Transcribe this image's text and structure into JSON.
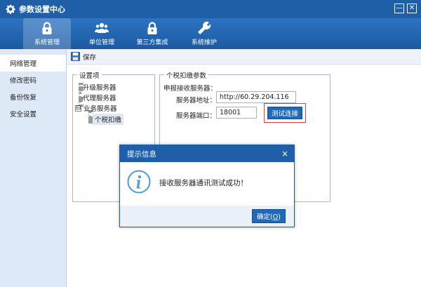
{
  "window": {
    "title": "参数设置中心",
    "icons": {
      "app": "gear-icon",
      "minimize": "minimize-icon",
      "close": "close-icon"
    },
    "minimize_glyph": "—",
    "close_glyph": "✕"
  },
  "nav": {
    "tabs": [
      {
        "label": "系统管理",
        "icon": "lock-icon",
        "active": true
      },
      {
        "label": "单位管理",
        "icon": "users-icon",
        "active": false
      },
      {
        "label": "第三方集成",
        "icon": "lock-icon",
        "active": false
      },
      {
        "label": "系统维护",
        "icon": "wrench-icon",
        "active": false
      }
    ]
  },
  "sidebar": {
    "items": [
      {
        "label": "网络管理",
        "active": true
      },
      {
        "label": "修改密码",
        "active": false
      },
      {
        "label": "备份恢复",
        "active": false
      },
      {
        "label": "安全设置",
        "active": false
      }
    ]
  },
  "toolbar": {
    "save_label": "保存",
    "save_icon": "floppy-disk-icon"
  },
  "settings_tree": {
    "legend": "设置项",
    "items": [
      {
        "label": "升级服务器"
      },
      {
        "label": "代理服务器"
      },
      {
        "label": "业务服务器",
        "toggle": "⊟"
      },
      {
        "label": "个税扣缴",
        "selected": true
      }
    ]
  },
  "tax_params": {
    "legend": "个税扣缴参数",
    "section_label": "申报接收服务器：",
    "address_label": "服务器地址：",
    "address_value": "http://60.29.204.116",
    "port_label": "服务器端口：",
    "port_value": "18001",
    "test_button": "测试连接"
  },
  "dialog": {
    "title": "提示信息",
    "close_glyph": "×",
    "message": "接收服务器通讯测试成功！",
    "icon": "info-icon",
    "ok_label": "确定(",
    "ok_key": "O",
    "ok_suffix": ")"
  },
  "colors": {
    "titlebar": "#1e5fa8",
    "accent": "#1f6ab6",
    "sidebar_bg": "#dde9f6",
    "highlight_border": "#e04040",
    "info_icon": "#4d9ad6"
  }
}
